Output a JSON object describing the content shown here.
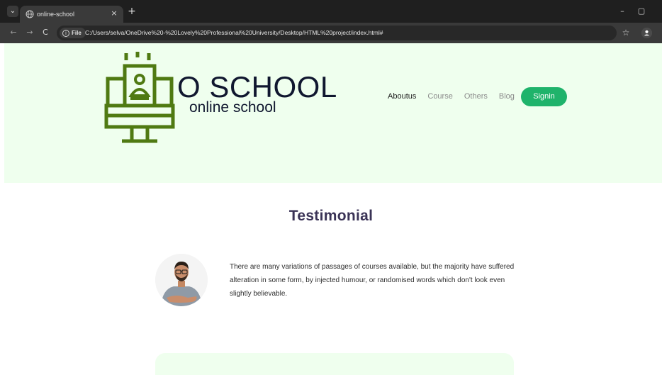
{
  "browser": {
    "tab_title": "online-school",
    "tab_close": "×",
    "new_tab": "+",
    "tab_list": "⌄",
    "back": "←",
    "forward": "→",
    "reload": "C",
    "site_chip": "File",
    "url": "C:/Users/selva/OneDrive%20-%20Lovely%20Professional%20University/Desktop/HTML%20project/index.html#",
    "minimize": "–",
    "restore": "▢",
    "bookmark": "☆"
  },
  "header": {
    "brand_name": "O SCHOOL",
    "brand_tagline": "online school",
    "nav": [
      {
        "label": "Aboutus"
      },
      {
        "label": "Course"
      },
      {
        "label": "Others"
      },
      {
        "label": "Blog"
      }
    ],
    "signin_label": "Signin"
  },
  "testimonial": {
    "title": "Testimonial",
    "text": "There are many variations of passages of courses available, but the majority have suffered alteration in some form, by injected humour, or randomised words which don't look even slightly believable."
  },
  "colors": {
    "header_bg": "#efffee",
    "logo_green": "#4f7a12",
    "accent": "#1fb36b",
    "title": "#3a3356",
    "brand": "#10172f"
  }
}
